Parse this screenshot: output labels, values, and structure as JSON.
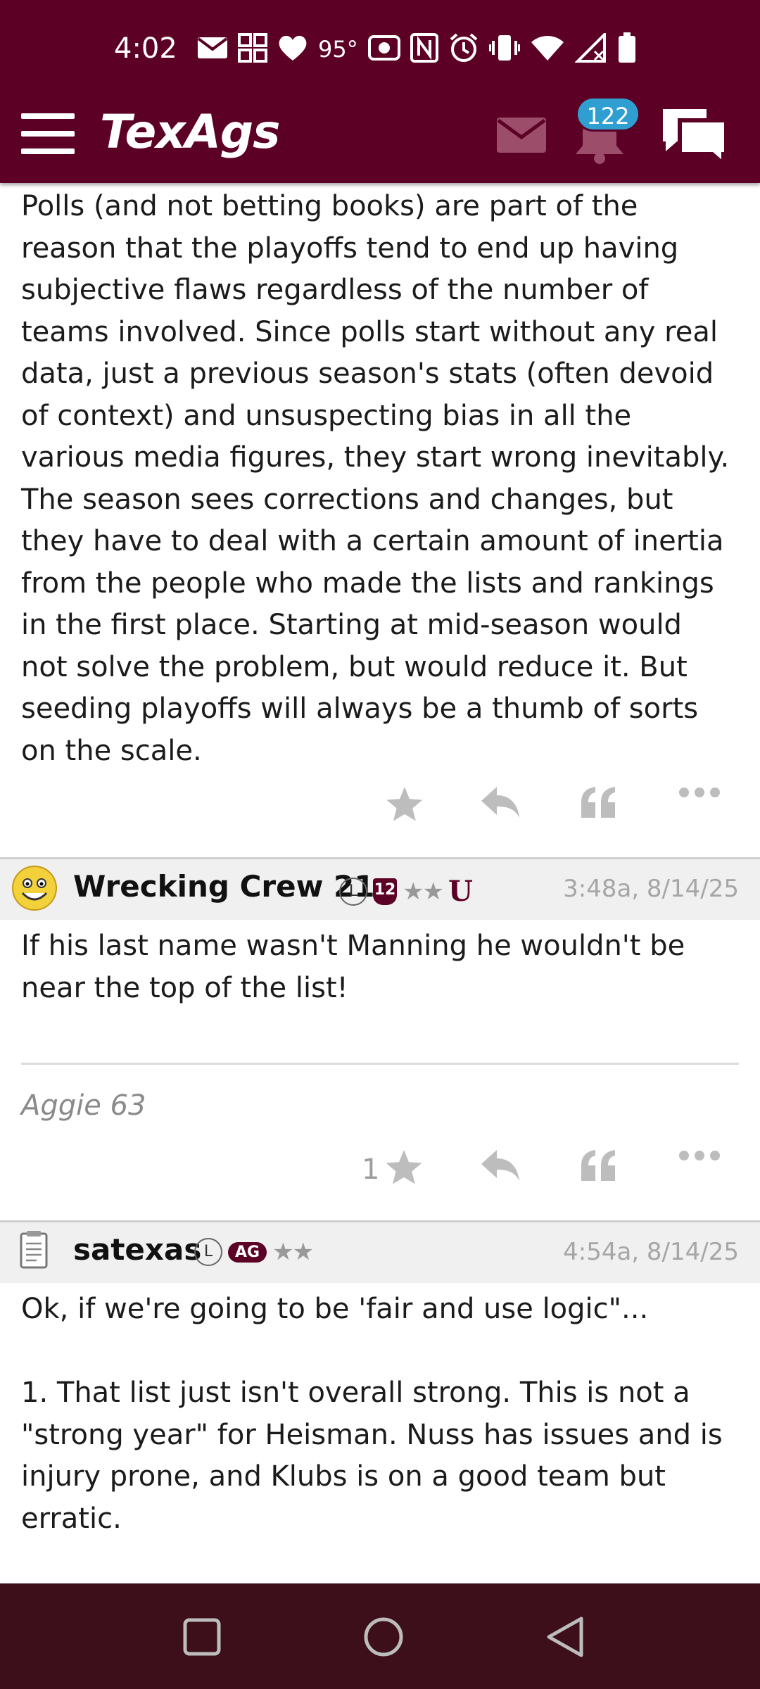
{
  "status_bar": {
    "time": "4:02",
    "temperature": "95°",
    "icons": [
      "mail-icon",
      "grid-icon",
      "heart-icon",
      "nfc-icon",
      "alarm-icon",
      "vibrate-icon",
      "wifi-icon",
      "signal-icon",
      "battery-icon"
    ]
  },
  "app_bar": {
    "logo": "TexAgs",
    "notification_count": "122",
    "icons": [
      "menu-icon",
      "mail-icon",
      "bell-icon",
      "chat-icon"
    ],
    "colors": {
      "bar": "#5c0025",
      "badge": "#2f9fd2"
    }
  },
  "posts": [
    {
      "body": "Polls (and not betting books) are part of the\nreason that the playoffs tend to end up having\nsubjective flaws regardless of the number of\nteams involved. Since polls start without any real\ndata, just a previous season's stats (often devoid\nof context) and unsuspecting bias in all the\nvarious media figures, they start wrong inevitably.\nThe season sees corrections and changes, but\nthey have to deal with a certain amount of inertia\nfrom the people who made the lists and rankings\nin the first place. Starting at mid-season would\nnot solve the problem, but would reduce it. But\nseeding playoffs will always be a thumb of sorts\non the scale.",
      "star_count": ""
    },
    {
      "username": "Wrecking Crew 21",
      "badges": [
        "L",
        "12",
        "★★",
        "U"
      ],
      "timestamp": "3:48a, 8/14/25",
      "body": "If his last name wasn't Manning he wouldn't be\nnear the top of the list!",
      "signature": "Aggie 63",
      "star_count": "1"
    },
    {
      "username": "satexas",
      "badges": [
        "L",
        "AG",
        "★★"
      ],
      "timestamp": "4:54a, 8/14/25",
      "body": "Ok, if we're going to be 'fair and use logic\"...\n\n1. That list just isn't overall strong. This is not a\n\"strong year\" for Heisman. Nuss has issues and is\ninjury prone, and Klubs is on a good team but\nerratic."
    }
  ],
  "nav_bar": {
    "icons": [
      "recents-icon",
      "home-icon",
      "back-icon"
    ]
  }
}
